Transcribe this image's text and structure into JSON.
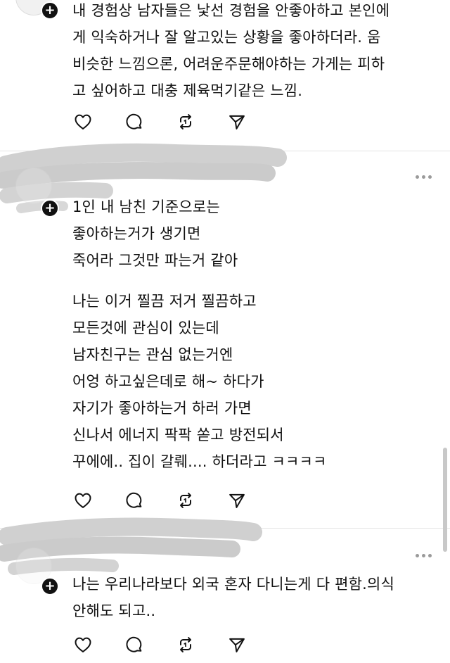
{
  "posts": [
    {
      "lines": [
        "내 경험상 남자들은 낯선 경험을 안좋아하고 본인에",
        "게 익숙하거나 잘 알고있는 상황을 좋아하더라. 움",
        "비슷한 느낌으론, 어려운주문해야하는 가게는 피하",
        "고 싶어하고 대충 제육먹기같은 느낌."
      ]
    },
    {
      "paragraph1": [
        "1인 내 남친 기준으로는",
        "좋아하는거가 생기면",
        "죽어라 그것만 파는거 같아"
      ],
      "paragraph2": [
        "나는 이거 찔끔 저거 찔끔하고",
        "모든것에 관심이 있는데",
        "남자친구는 관심 없는거엔",
        "어엉 하고싶은데로 해~ 하다가",
        "자기가 좋아하는거 하러 가면",
        "신나서 에너지 팍팍 쏟고 방전되서",
        "꾸에에.. 집이 갈뤠.... 하더라고 ㅋㅋㅋㅋ"
      ]
    },
    {
      "lines": [
        "나는 우리나라보다 외국 혼자 다니는게 다 편함.의식",
        "안해도 되고.."
      ]
    }
  ],
  "actions": [
    "heart-icon",
    "comment-icon",
    "repost-icon",
    "share-icon"
  ],
  "colors": {
    "text": "#111111",
    "divider": "#e4e4e4",
    "redaction": "#cfcfcf",
    "icon": "#111111"
  }
}
